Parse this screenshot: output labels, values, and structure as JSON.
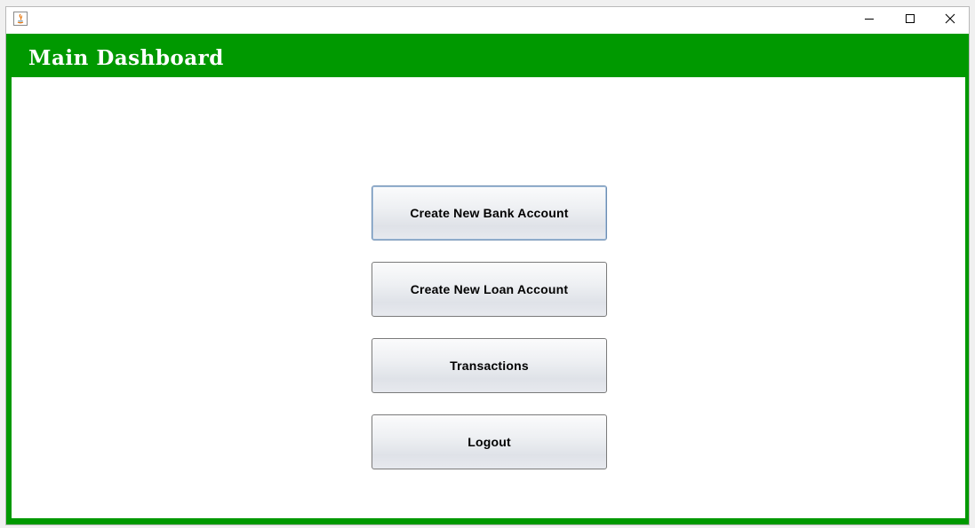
{
  "window": {
    "icon": "java-icon",
    "controls": {
      "minimize_icon": "minimize-icon",
      "maximize_icon": "maximize-icon",
      "close_icon": "close-icon"
    }
  },
  "header": {
    "title": "Main Dashboard"
  },
  "menu": {
    "buttons": [
      {
        "label": "Create New Bank Account"
      },
      {
        "label": "Create New Loan Account"
      },
      {
        "label": "Transactions"
      },
      {
        "label": "Logout"
      }
    ]
  },
  "colors": {
    "frame_green": "#009900",
    "header_text": "#ffffff",
    "content_bg": "#ffffff"
  }
}
